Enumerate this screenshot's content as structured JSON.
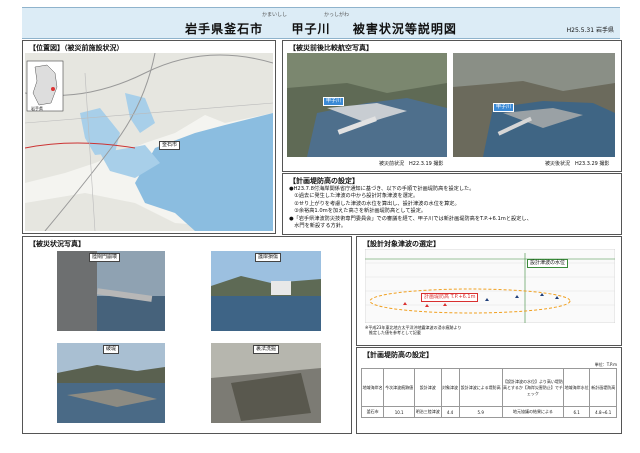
{
  "header": {
    "title_city": "岩手県釜石市",
    "title_river": "甲子川",
    "title_rest": "被害状況等説明図",
    "ruby_city": "かまいしし",
    "ruby_river": "かっしがわ",
    "date": "H25.5.31",
    "org": "岩手県"
  },
  "location_panel": {
    "heading": "【位置図】（被災前施設状況）",
    "place_labels": [
      "釜石市",
      "岩手県"
    ]
  },
  "aerial_panel": {
    "heading": "【被災前後比較航空写真】",
    "river_label": "甲子川",
    "caption_before": "被災前状況　H22.3.19 撮影",
    "caption_after": "被災後状況　H23.3.29 撮影"
  },
  "plan_panel": {
    "heading": "【計画堤防高の設定】",
    "lines": [
      "●H23.7.8付海岸関係省庁通知に基づき、以下の手順で計画堤防高を設定した。",
      "　①過去に発生した津波の中から設計対象津波を選定。",
      "　②せり上がりを考慮した津波の水位を算出し、設計津波の水位を算定。",
      "　③余裕高1.0mを加えた高さを新計画堤防高として設定。",
      "●「岩手県津波防災技術専門委員会」での審議を経て、甲子川では新計画堤防高をT.P.+6.1mと設定し、",
      "　水門を新設する方針。"
    ]
  },
  "damage_panel": {
    "heading": "【被災状況写真】",
    "photos": [
      {
        "label": "陸閘門崩壊"
      },
      {
        "label": "護岸損傷"
      },
      {
        "label": "破堤"
      },
      {
        "label": "裏法洗掘"
      }
    ]
  },
  "tsunami_panel": {
    "heading": "【設計対象津波の選定】",
    "legend_top": "設計津波の水位",
    "legend_mid": "計画堤防高 T.P.+6.1m",
    "note_lines": [
      "※平成23年東北地方太平洋沖地震津波の浸水痕跡より",
      "　推定した値を参考として記載"
    ]
  },
  "height_panel": {
    "heading": "【計画堤防高の設定】",
    "unit": "単位：T.P.m",
    "col_headers": [
      "地域海岸名",
      "今次津波痕跡値",
      "設計津波",
      "対象津波",
      "設計津波による堤防高",
      "【設計津波の水位】より高い堤防高とするか【海岸災害防止】でチェック",
      "地域海岸水位",
      "新計画堤防高"
    ],
    "row": [
      "釜石市",
      "10.1",
      "明治三陸津波",
      "4.4",
      "5.9",
      "地元協議の結果による",
      "6.1",
      "4.8→6.1"
    ]
  }
}
